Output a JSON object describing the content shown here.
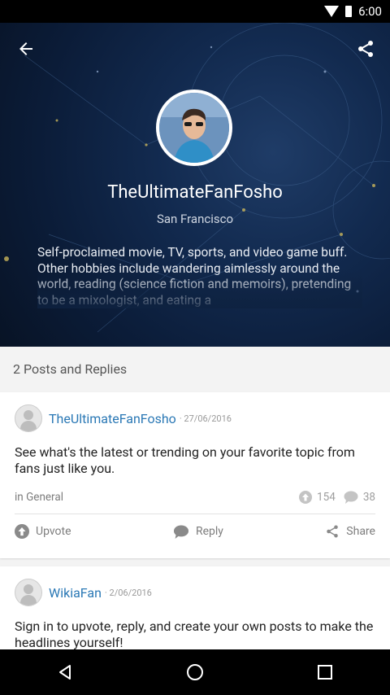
{
  "status": {
    "time": "6:00"
  },
  "profile": {
    "username": "TheUltimateFanFosho",
    "location": "San Francisco",
    "bio": "Self-proclaimed movie, TV, sports, and video game buff. Other hobbies include wandering aimlessly around the world, reading (science fiction and memoirs), pretending to be a mixologist, and eating a"
  },
  "posts_header": "2 Posts and Replies",
  "posts": [
    {
      "author": "TheUltimateFanFosho",
      "date": "· 27/06/2016",
      "text": "See what's the latest or trending on your favorite topic from fans just like you.",
      "category": "in General",
      "upvotes": "154",
      "replies": "38",
      "actions": {
        "upvote": "Upvote",
        "reply": "Reply",
        "share": "Share"
      }
    },
    {
      "author": "WikiaFan",
      "date": "· 2/06/2016",
      "text": "Sign in to upvote, reply, and create your own posts to make the headlines yourself!"
    }
  ],
  "colors": {
    "link": "#2a78b5",
    "hero": "#0b1c38"
  }
}
